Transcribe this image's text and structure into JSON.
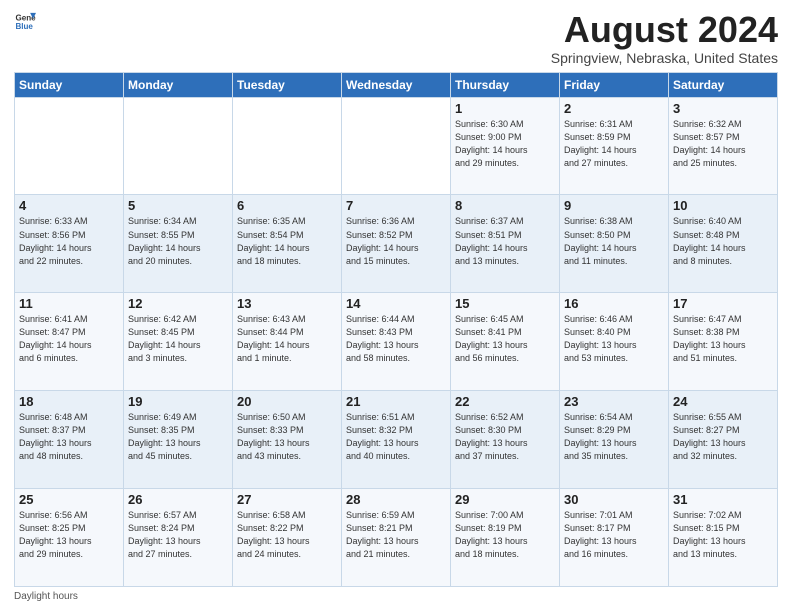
{
  "logo": {
    "general": "General",
    "blue": "Blue"
  },
  "title": "August 2024",
  "subtitle": "Springview, Nebraska, United States",
  "headers": [
    "Sunday",
    "Monday",
    "Tuesday",
    "Wednesday",
    "Thursday",
    "Friday",
    "Saturday"
  ],
  "footer": "Daylight hours",
  "weeks": [
    [
      {
        "day": "",
        "info": ""
      },
      {
        "day": "",
        "info": ""
      },
      {
        "day": "",
        "info": ""
      },
      {
        "day": "",
        "info": ""
      },
      {
        "day": "1",
        "info": "Sunrise: 6:30 AM\nSunset: 9:00 PM\nDaylight: 14 hours\nand 29 minutes."
      },
      {
        "day": "2",
        "info": "Sunrise: 6:31 AM\nSunset: 8:59 PM\nDaylight: 14 hours\nand 27 minutes."
      },
      {
        "day": "3",
        "info": "Sunrise: 6:32 AM\nSunset: 8:57 PM\nDaylight: 14 hours\nand 25 minutes."
      }
    ],
    [
      {
        "day": "4",
        "info": "Sunrise: 6:33 AM\nSunset: 8:56 PM\nDaylight: 14 hours\nand 22 minutes."
      },
      {
        "day": "5",
        "info": "Sunrise: 6:34 AM\nSunset: 8:55 PM\nDaylight: 14 hours\nand 20 minutes."
      },
      {
        "day": "6",
        "info": "Sunrise: 6:35 AM\nSunset: 8:54 PM\nDaylight: 14 hours\nand 18 minutes."
      },
      {
        "day": "7",
        "info": "Sunrise: 6:36 AM\nSunset: 8:52 PM\nDaylight: 14 hours\nand 15 minutes."
      },
      {
        "day": "8",
        "info": "Sunrise: 6:37 AM\nSunset: 8:51 PM\nDaylight: 14 hours\nand 13 minutes."
      },
      {
        "day": "9",
        "info": "Sunrise: 6:38 AM\nSunset: 8:50 PM\nDaylight: 14 hours\nand 11 minutes."
      },
      {
        "day": "10",
        "info": "Sunrise: 6:40 AM\nSunset: 8:48 PM\nDaylight: 14 hours\nand 8 minutes."
      }
    ],
    [
      {
        "day": "11",
        "info": "Sunrise: 6:41 AM\nSunset: 8:47 PM\nDaylight: 14 hours\nand 6 minutes."
      },
      {
        "day": "12",
        "info": "Sunrise: 6:42 AM\nSunset: 8:45 PM\nDaylight: 14 hours\nand 3 minutes."
      },
      {
        "day": "13",
        "info": "Sunrise: 6:43 AM\nSunset: 8:44 PM\nDaylight: 14 hours\nand 1 minute."
      },
      {
        "day": "14",
        "info": "Sunrise: 6:44 AM\nSunset: 8:43 PM\nDaylight: 13 hours\nand 58 minutes."
      },
      {
        "day": "15",
        "info": "Sunrise: 6:45 AM\nSunset: 8:41 PM\nDaylight: 13 hours\nand 56 minutes."
      },
      {
        "day": "16",
        "info": "Sunrise: 6:46 AM\nSunset: 8:40 PM\nDaylight: 13 hours\nand 53 minutes."
      },
      {
        "day": "17",
        "info": "Sunrise: 6:47 AM\nSunset: 8:38 PM\nDaylight: 13 hours\nand 51 minutes."
      }
    ],
    [
      {
        "day": "18",
        "info": "Sunrise: 6:48 AM\nSunset: 8:37 PM\nDaylight: 13 hours\nand 48 minutes."
      },
      {
        "day": "19",
        "info": "Sunrise: 6:49 AM\nSunset: 8:35 PM\nDaylight: 13 hours\nand 45 minutes."
      },
      {
        "day": "20",
        "info": "Sunrise: 6:50 AM\nSunset: 8:33 PM\nDaylight: 13 hours\nand 43 minutes."
      },
      {
        "day": "21",
        "info": "Sunrise: 6:51 AM\nSunset: 8:32 PM\nDaylight: 13 hours\nand 40 minutes."
      },
      {
        "day": "22",
        "info": "Sunrise: 6:52 AM\nSunset: 8:30 PM\nDaylight: 13 hours\nand 37 minutes."
      },
      {
        "day": "23",
        "info": "Sunrise: 6:54 AM\nSunset: 8:29 PM\nDaylight: 13 hours\nand 35 minutes."
      },
      {
        "day": "24",
        "info": "Sunrise: 6:55 AM\nSunset: 8:27 PM\nDaylight: 13 hours\nand 32 minutes."
      }
    ],
    [
      {
        "day": "25",
        "info": "Sunrise: 6:56 AM\nSunset: 8:25 PM\nDaylight: 13 hours\nand 29 minutes."
      },
      {
        "day": "26",
        "info": "Sunrise: 6:57 AM\nSunset: 8:24 PM\nDaylight: 13 hours\nand 27 minutes."
      },
      {
        "day": "27",
        "info": "Sunrise: 6:58 AM\nSunset: 8:22 PM\nDaylight: 13 hours\nand 24 minutes."
      },
      {
        "day": "28",
        "info": "Sunrise: 6:59 AM\nSunset: 8:21 PM\nDaylight: 13 hours\nand 21 minutes."
      },
      {
        "day": "29",
        "info": "Sunrise: 7:00 AM\nSunset: 8:19 PM\nDaylight: 13 hours\nand 18 minutes."
      },
      {
        "day": "30",
        "info": "Sunrise: 7:01 AM\nSunset: 8:17 PM\nDaylight: 13 hours\nand 16 minutes."
      },
      {
        "day": "31",
        "info": "Sunrise: 7:02 AM\nSunset: 8:15 PM\nDaylight: 13 hours\nand 13 minutes."
      }
    ]
  ]
}
